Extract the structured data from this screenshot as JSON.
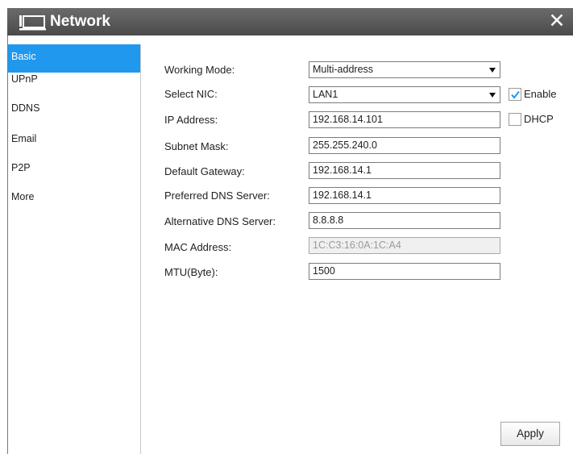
{
  "window": {
    "title": "Network",
    "close_glyph": "✕"
  },
  "sidebar": {
    "items": [
      {
        "label": "Basic",
        "active": true
      },
      {
        "label": "UPnP"
      },
      {
        "label": "DDNS"
      },
      {
        "label": "Email"
      },
      {
        "label": "P2P"
      },
      {
        "label": "More"
      }
    ]
  },
  "form": {
    "working_mode": {
      "label": "Working Mode:",
      "value": "Multi-address"
    },
    "select_nic": {
      "label": "Select NIC:",
      "value": "LAN1"
    },
    "ip_address": {
      "label": "IP Address:",
      "value": "192.168.14.101"
    },
    "subnet_mask": {
      "label": "Subnet Mask:",
      "value": "255.255.240.0"
    },
    "default_gateway": {
      "label": "Default Gateway:",
      "value": "192.168.14.1"
    },
    "preferred_dns": {
      "label": "Preferred DNS Server:",
      "value": "192.168.14.1"
    },
    "alternative_dns": {
      "label": "Alternative DNS Server:",
      "value": "8.8.8.8"
    },
    "mac_address": {
      "label": "MAC Address:",
      "value": "1C:C3:16:0A:1C:A4"
    },
    "mtu": {
      "label": "MTU(Byte):",
      "value": "1500"
    }
  },
  "checkboxes": {
    "enable": {
      "label": "Enable",
      "checked": true
    },
    "dhcp": {
      "label": "DHCP",
      "checked": false
    }
  },
  "buttons": {
    "apply": "Apply"
  },
  "icons": {
    "app": "network-monitor-icon",
    "close": "close-icon",
    "dropdown": "chevron-down-icon",
    "check": "checkmark-icon"
  },
  "colors": {
    "accent": "#1f98ee",
    "titlebar": "#5a5a5a",
    "check": "#1f98ee"
  }
}
